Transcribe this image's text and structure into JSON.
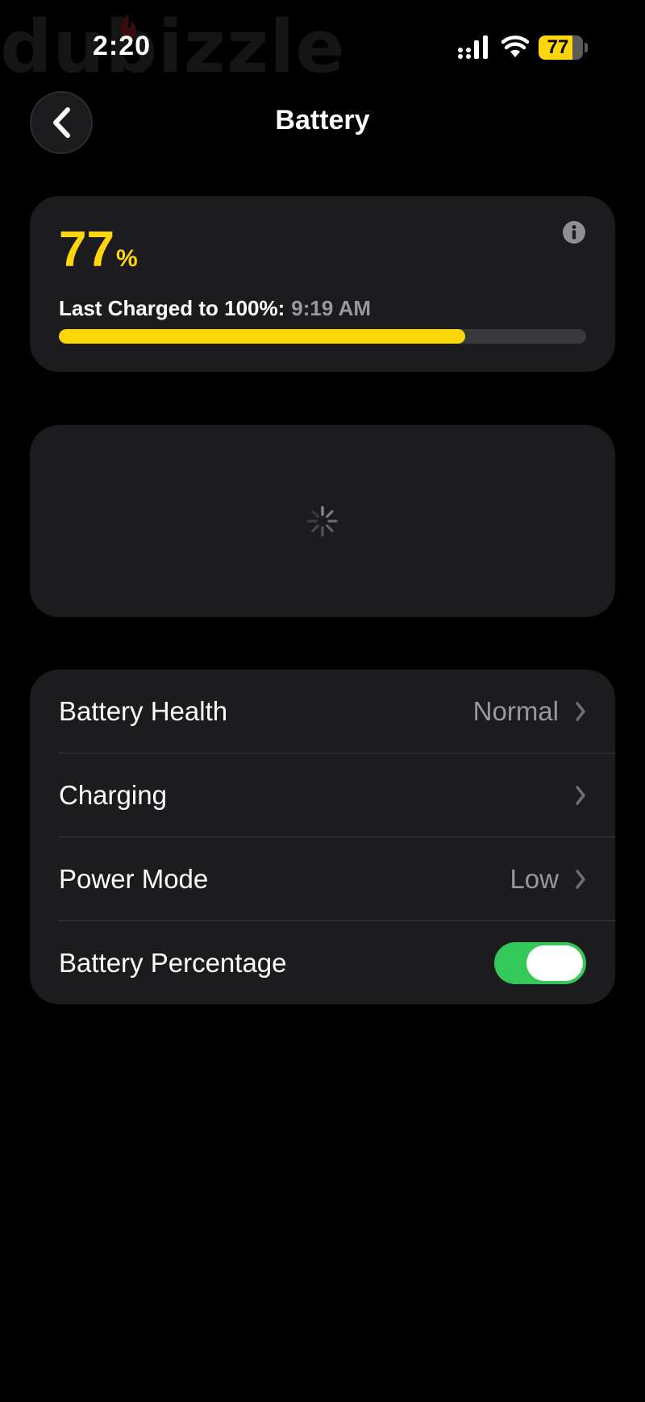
{
  "watermark": {
    "text": "dubizzle"
  },
  "status_bar": {
    "time": "2:20",
    "battery_level": "77",
    "battery_fraction": 0.77
  },
  "header": {
    "title": "Battery",
    "back_icon": "chevron-left-icon"
  },
  "level_card": {
    "value": "77",
    "unit": "%",
    "last_charged_label": "Last Charged to 100%:",
    "last_charged_time": "9:19 AM",
    "progress_fraction": 0.77,
    "info_icon": "info-icon"
  },
  "chart_card": {
    "loading_icon": "spinner-icon"
  },
  "settings": {
    "rows": [
      {
        "label": "Battery Health",
        "value": "Normal"
      },
      {
        "label": "Charging",
        "value": ""
      },
      {
        "label": "Power Mode",
        "value": "Low"
      },
      {
        "label": "Battery Percentage",
        "toggle_on": true
      }
    ]
  },
  "colors": {
    "background": "#000000",
    "card": "#1c1c1e",
    "accent_yellow": "#ffd60a",
    "toggle_green": "#34c759",
    "secondary_text": "#98989e"
  }
}
